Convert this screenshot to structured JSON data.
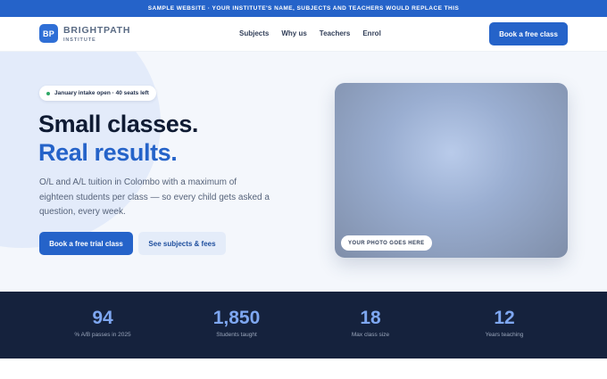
{
  "banner": {
    "text": "SAMPLE WEBSITE · YOUR INSTITUTE'S NAME, SUBJECTS AND TEACHERS WOULD REPLACE THIS"
  },
  "brand": {
    "initials": "BP",
    "name": "BRIGHTPATH",
    "sub": "INSTITUTE"
  },
  "nav": {
    "links": [
      "Subjects",
      "Why us",
      "Teachers",
      "Enrol"
    ],
    "cta": "Book a free class"
  },
  "hero": {
    "pill": "January intake open · 40 seats left",
    "headline_line1": "Small classes.",
    "headline_line2": "Real results.",
    "lede": "O/L and A/L tuition in Colombo with a maximum of eighteen students per class — so every child gets asked a question, every week.",
    "primary_button": "Book a free trial class",
    "secondary_button": "See subjects & fees",
    "photo_tag": "YOUR PHOTO GOES HERE"
  },
  "stats": [
    {
      "value": "94",
      "label": "% A/B passes in 2025"
    },
    {
      "value": "1,850",
      "label": "Students taught"
    },
    {
      "value": "18",
      "label": "Max class size"
    },
    {
      "value": "12",
      "label": "Years teaching"
    }
  ],
  "colors": {
    "accent": "#2563c9",
    "headline_accent": "#2563c9",
    "stats_bg": "#15223d",
    "stats_value": "#7ea7f1",
    "pill_dot": "#2fa866"
  }
}
